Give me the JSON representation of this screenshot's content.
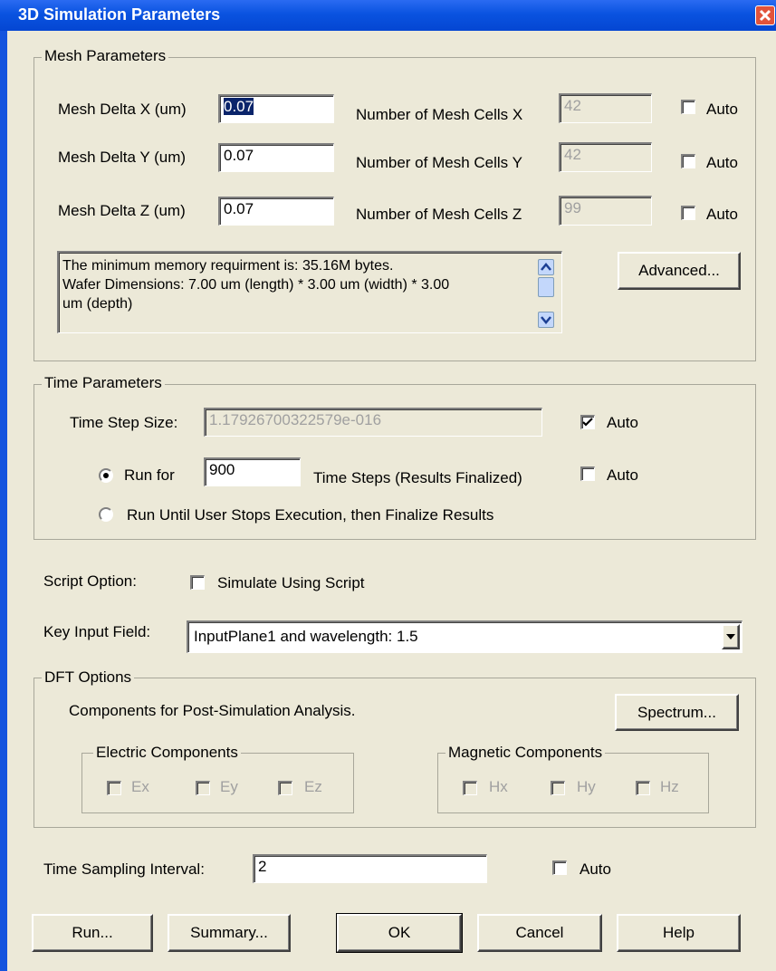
{
  "window": {
    "title": "3D Simulation Parameters"
  },
  "mesh": {
    "legend": "Mesh Parameters",
    "delta_x_label": "Mesh Delta X (um)",
    "delta_x_value": "0.07",
    "delta_y_label": "Mesh Delta Y (um)",
    "delta_y_value": "0.07",
    "delta_z_label": "Mesh Delta Z (um)",
    "delta_z_value": "0.07",
    "cells_x_label": "Number of Mesh Cells X",
    "cells_x_value": "42",
    "cells_y_label": "Number of Mesh Cells Y",
    "cells_y_value": "42",
    "cells_z_label": "Number of Mesh Cells Z",
    "cells_z_value": "99",
    "auto_x_label": "Auto",
    "auto_x_checked": false,
    "auto_y_label": "Auto",
    "auto_y_checked": false,
    "auto_z_label": "Auto",
    "auto_z_checked": false,
    "info_line1": "The minimum memory requirment is: 35.16M bytes.",
    "info_line2": "Wafer Dimensions: 7.00 um (length) * 3.00 um (width) * 3.00",
    "info_line3": "um (depth)",
    "advanced_label": "Advanced..."
  },
  "time": {
    "legend": "Time Parameters",
    "step_size_label": "Time Step Size:",
    "step_size_value": "1.17926700322579e-016",
    "step_auto_label": "Auto",
    "step_auto_checked": true,
    "run_for_label": "Run for",
    "run_for_value": "900",
    "time_steps_label": "Time Steps (Results Finalized)",
    "run_auto_label": "Auto",
    "run_auto_checked": false,
    "run_until_label": "Run Until User Stops Execution, then Finalize Results",
    "selected_option": "run_for"
  },
  "script": {
    "label": "Script Option:",
    "checkbox_label": "Simulate Using Script",
    "checked": false
  },
  "key_input": {
    "label": "Key Input Field:",
    "selected": "InputPlane1 and wavelength: 1.5"
  },
  "dft": {
    "legend": "DFT Options",
    "description": "Components for Post-Simulation Analysis.",
    "spectrum_label": "Spectrum...",
    "electric_legend": "Electric Components",
    "magnetic_legend": "Magnetic Components",
    "ex": "Ex",
    "ey": "Ey",
    "ez": "Ez",
    "hx": "Hx",
    "hy": "Hy",
    "hz": "Hz"
  },
  "sampling": {
    "label": "Time Sampling Interval:",
    "value": "2",
    "auto_label": "Auto",
    "auto_checked": false
  },
  "buttons": {
    "run": "Run...",
    "summary": "Summary...",
    "ok": "OK",
    "cancel": "Cancel",
    "help": "Help"
  },
  "colors": {
    "titlebar": "#0a53e0",
    "dialog_bg": "#ece9d8",
    "selection": "#0a246a",
    "disabled_text": "#a0a0a0"
  },
  "icons": {
    "close": "close-icon",
    "check": "check-icon",
    "dropdown": "chevron-down-icon",
    "scroll_up": "scroll-up-icon",
    "scroll_down": "scroll-down-icon"
  }
}
